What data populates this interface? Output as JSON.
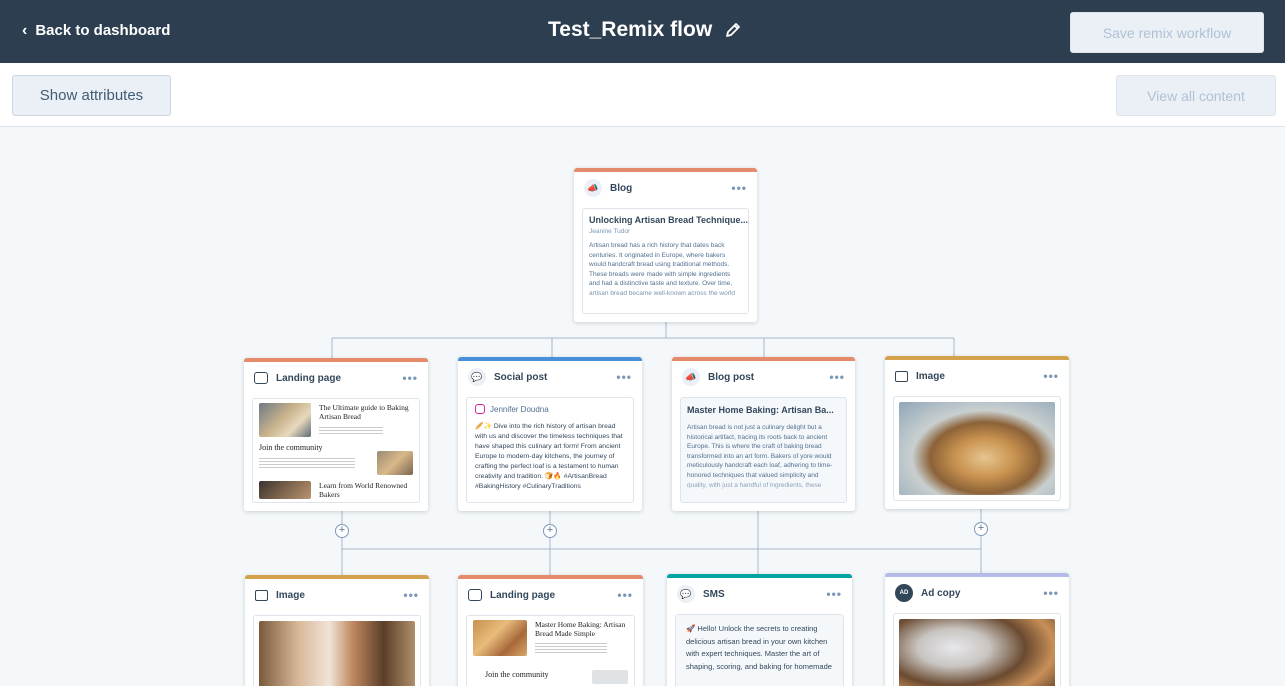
{
  "header": {
    "back_label": "Back to dashboard",
    "title": "Test_Remix flow",
    "save_label": "Save remix workflow"
  },
  "toolbar": {
    "show_attributes_label": "Show attributes",
    "view_all_label": "View all content"
  },
  "colors": {
    "header_bg": "#2d3e50",
    "blog_accent": "#e68a6c",
    "social_accent": "#4a90d9",
    "image_accent": "#d4a24c",
    "sms_accent": "#00a4a3",
    "adcopy_accent": "#b4bbe8"
  },
  "blog": {
    "type": "Blog",
    "icon": "megaphone-icon",
    "title": "Unlocking Artisan Bread Technique...",
    "author": "Jeanine Tudor",
    "body": "Artisan bread has a rich history that dates back centuries. It originated in Europe, where bakers would handcraft bread using traditional methods. These breads were made with simple ingredients and had a distinctive taste and texture. Over time, artisan bread became well-known across the world"
  },
  "landing1": {
    "type": "Landing page",
    "icon": "browser-window-icon",
    "heading": "The Ultimate guide to Baking Artisan Bread",
    "section": "Join the community",
    "section2": "Learn from World Renowned Bakers"
  },
  "social": {
    "type": "Social post",
    "icon": "chat-bubble-icon",
    "account": "Jennifer Doudna",
    "body": "🥖✨ Dive into the rich history of artisan bread with us and discover the timeless techniques that have shaped this culinary art form! From ancient Europe to modern-day kitchens, the journey of crafting the perfect loaf is a testament to human creativity and tradition. 🍞🔥 #ArtisanBread #BakingHistory #CulinaryTraditions"
  },
  "blogpost": {
    "type": "Blog post",
    "icon": "megaphone-icon",
    "title": "Master Home Baking: Artisan Ba...",
    "body": "Artisan bread is not just a culinary delight but a historical artifact, tracing its roots back to ancient Europe. This is where the craft of baking bread transformed into an art form. Bakers of yore would meticulously handcraft each loaf, adhering to time-honored techniques that valued simplicity and quality, with just a handful of ingredients, these"
  },
  "image1": {
    "type": "Image",
    "icon": "image-icon"
  },
  "image2": {
    "type": "Image",
    "icon": "image-icon"
  },
  "landing2": {
    "type": "Landing page",
    "icon": "browser-window-icon",
    "heading": "Master Home Baking: Artisan Bread Made Simple",
    "section": "Join the community"
  },
  "sms": {
    "type": "SMS",
    "icon": "sms-icon",
    "body": "🚀 Hello! Unlock the secrets to creating delicious artisan bread in your own kitchen with expert techniques. Master the art of shaping, scoring, and baking for homemade"
  },
  "adcopy": {
    "type": "Ad copy",
    "icon": "ad-icon",
    "icon_text": "AD"
  }
}
